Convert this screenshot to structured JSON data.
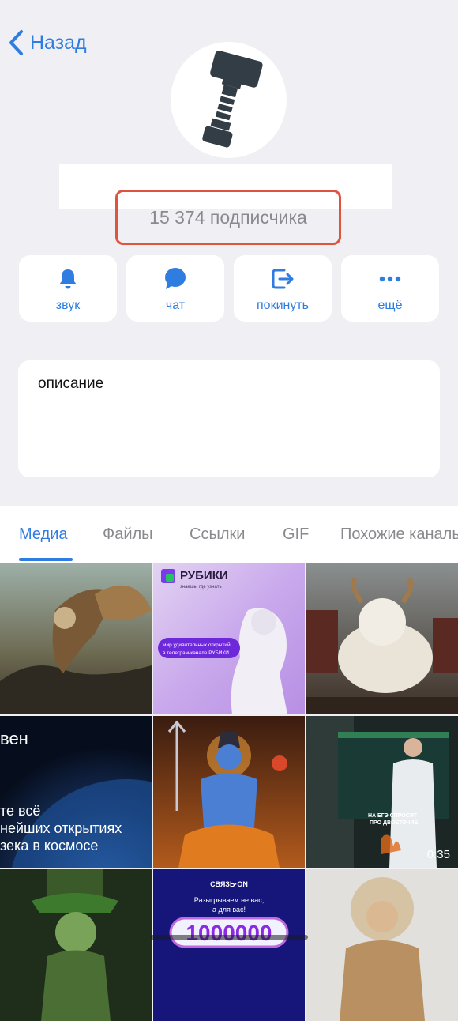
{
  "header": {
    "back_label": "Назад"
  },
  "channel": {
    "subscribers": "15 374 подписчика"
  },
  "actions": [
    {
      "label": "звук",
      "icon": "bell-icon"
    },
    {
      "label": "чат",
      "icon": "chat-bubble-icon"
    },
    {
      "label": "покинуть",
      "icon": "leave-icon"
    },
    {
      "label": "ещё",
      "icon": "more-icon"
    }
  ],
  "description": {
    "label": "описание"
  },
  "tabs": [
    {
      "label": "Медиа",
      "active": true
    },
    {
      "label": "Файлы",
      "active": false
    },
    {
      "label": "Ссылки",
      "active": false
    },
    {
      "label": "GIF",
      "active": false
    },
    {
      "label": "Похожие каналы",
      "active": false
    }
  ],
  "media": {
    "rubiki_title": "РУБИКИ",
    "rubiki_tagline": "знаешь, где узнать",
    "rubiki_caption_1": "мир удивительных открытий",
    "rubiki_caption_2": "в телеграм-канале РУБИКИ",
    "space_line_1": "вен",
    "space_line_2": "те всё",
    "space_line_3": "нейших открытиях",
    "space_line_4": "зека в космосе",
    "video_caption_1": "НА ЕГЭ СПРОСЯТ",
    "video_caption_2": "ПРО ДВОЕТОЧИЕ",
    "video_duration": "0:35",
    "promo_brand": "СВЯЗЬ·ON",
    "promo_line_1": "Разыгрываем не вас,",
    "promo_line_2": "а для вас!",
    "promo_amount": "1000000"
  },
  "colors": {
    "accent": "#2f7de1",
    "background": "#efeff4",
    "highlight": "#e0533f"
  }
}
